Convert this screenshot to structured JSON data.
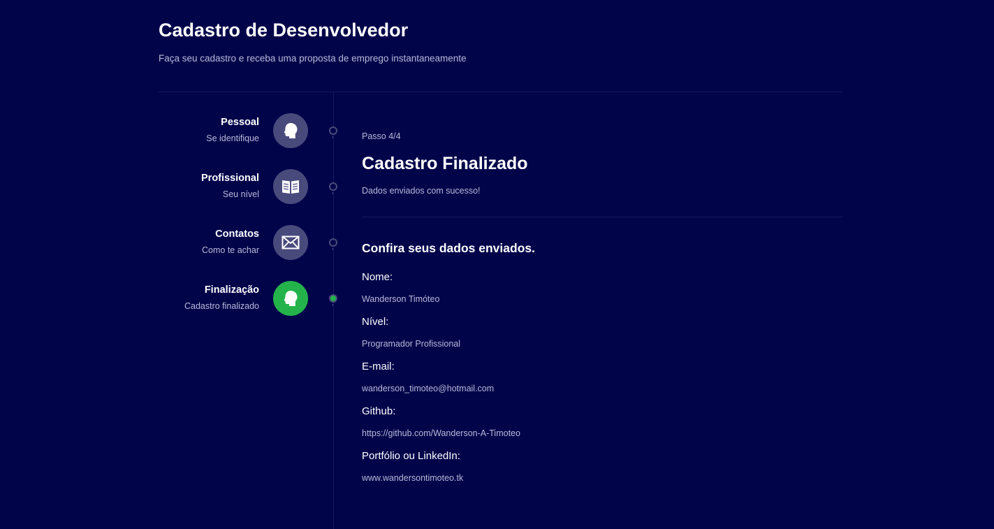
{
  "header": {
    "title": "Cadastro de Desenvolvedor",
    "subtitle": "Faça seu cadastro e receba uma proposta de emprego instantaneamente"
  },
  "steps": [
    {
      "title": "Pessoal",
      "subtitle": "Se identifique",
      "icon": "profile-head-icon",
      "active": false
    },
    {
      "title": "Profissional",
      "subtitle": "Seu nível",
      "icon": "book-icon",
      "active": false
    },
    {
      "title": "Contatos",
      "subtitle": "Como te achar",
      "icon": "envelope-icon",
      "active": false
    },
    {
      "title": "Finalização",
      "subtitle": "Cadastro finalizado",
      "icon": "profile-head-icon",
      "active": true
    }
  ],
  "content": {
    "step_counter": "Passo 4/4",
    "title": "Cadastro Finalizado",
    "description": "Dados enviados com sucesso!",
    "summary_title": "Confira seus dados enviados.",
    "fields": [
      {
        "label": "Nome:",
        "value": "Wanderson Timóteo"
      },
      {
        "label": "Nível:",
        "value": "Programador Profissional"
      },
      {
        "label": "E-mail:",
        "value": "wanderson_timoteo@hotmail.com"
      },
      {
        "label": "Github:",
        "value": "https://github.com/Wanderson-A-Timoteo"
      },
      {
        "label": "Portfólio ou LinkedIn:",
        "value": "www.wandersontimoteo.tk"
      }
    ]
  },
  "colors": {
    "background": "#02044a",
    "icon_inactive": "#494a7c",
    "icon_active": "#24b34b",
    "muted_text": "#b8b9d9",
    "divider": "#16195c"
  }
}
